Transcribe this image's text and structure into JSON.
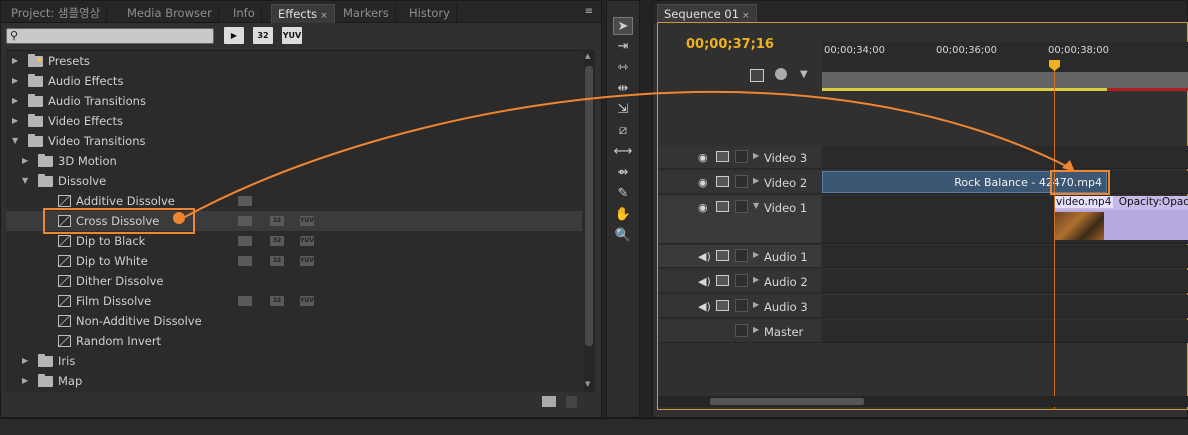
{
  "effects_panel": {
    "tabs": [
      {
        "label": "Project: 샘플영상"
      },
      {
        "label": "Media Browser"
      },
      {
        "label": "Info"
      },
      {
        "label": "Effects",
        "close": "×"
      },
      {
        "label": "Markers"
      },
      {
        "label": "History"
      }
    ],
    "menu_icon": "≡",
    "search": {
      "value": "",
      "placeholder": ""
    },
    "format_buttons": [
      "▶",
      "32",
      "YUV"
    ],
    "tree": [
      {
        "label": "Presets",
        "expanded": false,
        "type": "folder-star"
      },
      {
        "label": "Audio Effects",
        "expanded": false,
        "type": "folder"
      },
      {
        "label": "Audio Transitions",
        "expanded": false,
        "type": "folder"
      },
      {
        "label": "Video Effects",
        "expanded": false,
        "type": "folder"
      },
      {
        "label": "Video Transitions",
        "expanded": true,
        "type": "folder"
      },
      {
        "label": "3D Motion",
        "expanded": false,
        "type": "folder"
      },
      {
        "label": "Dissolve",
        "expanded": true,
        "type": "folder"
      },
      {
        "label": "Additive Dissolve",
        "type": "transition",
        "badges": [
          "acc"
        ]
      },
      {
        "label": "Cross Dissolve",
        "type": "transition",
        "badges": [
          "acc",
          "32",
          "YUV"
        ],
        "selected": true
      },
      {
        "label": "Dip to Black",
        "type": "transition",
        "badges": [
          "acc",
          "32",
          "YUV"
        ]
      },
      {
        "label": "Dip to White",
        "type": "transition",
        "badges": [
          "acc",
          "32",
          "YUV"
        ]
      },
      {
        "label": "Dither Dissolve",
        "type": "transition",
        "badges": []
      },
      {
        "label": "Film Dissolve",
        "type": "transition",
        "badges": [
          "acc",
          "32",
          "YUV"
        ]
      },
      {
        "label": "Non-Additive Dissolve",
        "type": "transition",
        "badges": []
      },
      {
        "label": "Random Invert",
        "type": "transition",
        "badges": []
      },
      {
        "label": "Iris",
        "expanded": false,
        "type": "folder"
      },
      {
        "label": "Map",
        "expanded": false,
        "type": "folder"
      }
    ]
  },
  "tools": [
    "selection-tool",
    "track-select-tool",
    "ripple-edit-tool",
    "rolling-edit-tool",
    "rate-stretch-tool",
    "razor-tool",
    "slip-tool",
    "slide-tool",
    "pen-tool",
    "hand-tool",
    "zoom-tool"
  ],
  "sequence_panel": {
    "tab_label": "Sequence 01",
    "tab_close": "×",
    "timecode": "00;00;37;16",
    "ruler_labels": [
      "00;00;34;00",
      "00;00;36;00",
      "00;00;38;00"
    ],
    "tracks": [
      {
        "name": "Video 3",
        "kind": "video"
      },
      {
        "name": "Video 2",
        "kind": "video"
      },
      {
        "name": "Video 1",
        "kind": "video",
        "expanded": true
      },
      {
        "name": "Audio 1",
        "kind": "audio"
      },
      {
        "name": "Audio 2",
        "kind": "audio"
      },
      {
        "name": "Audio 3",
        "kind": "audio"
      },
      {
        "name": "Master",
        "kind": "master"
      }
    ],
    "clip_video2": "Rock Balance - 42470.mp4",
    "clip_video1_name": "video.mp4",
    "clip_video1_fx": "Opacity:Opacity"
  },
  "colors": {
    "accent": "#f08530",
    "timecode": "#f0b020",
    "clip_blue": "#3c5774",
    "clip_purple": "#b8a8e0"
  }
}
